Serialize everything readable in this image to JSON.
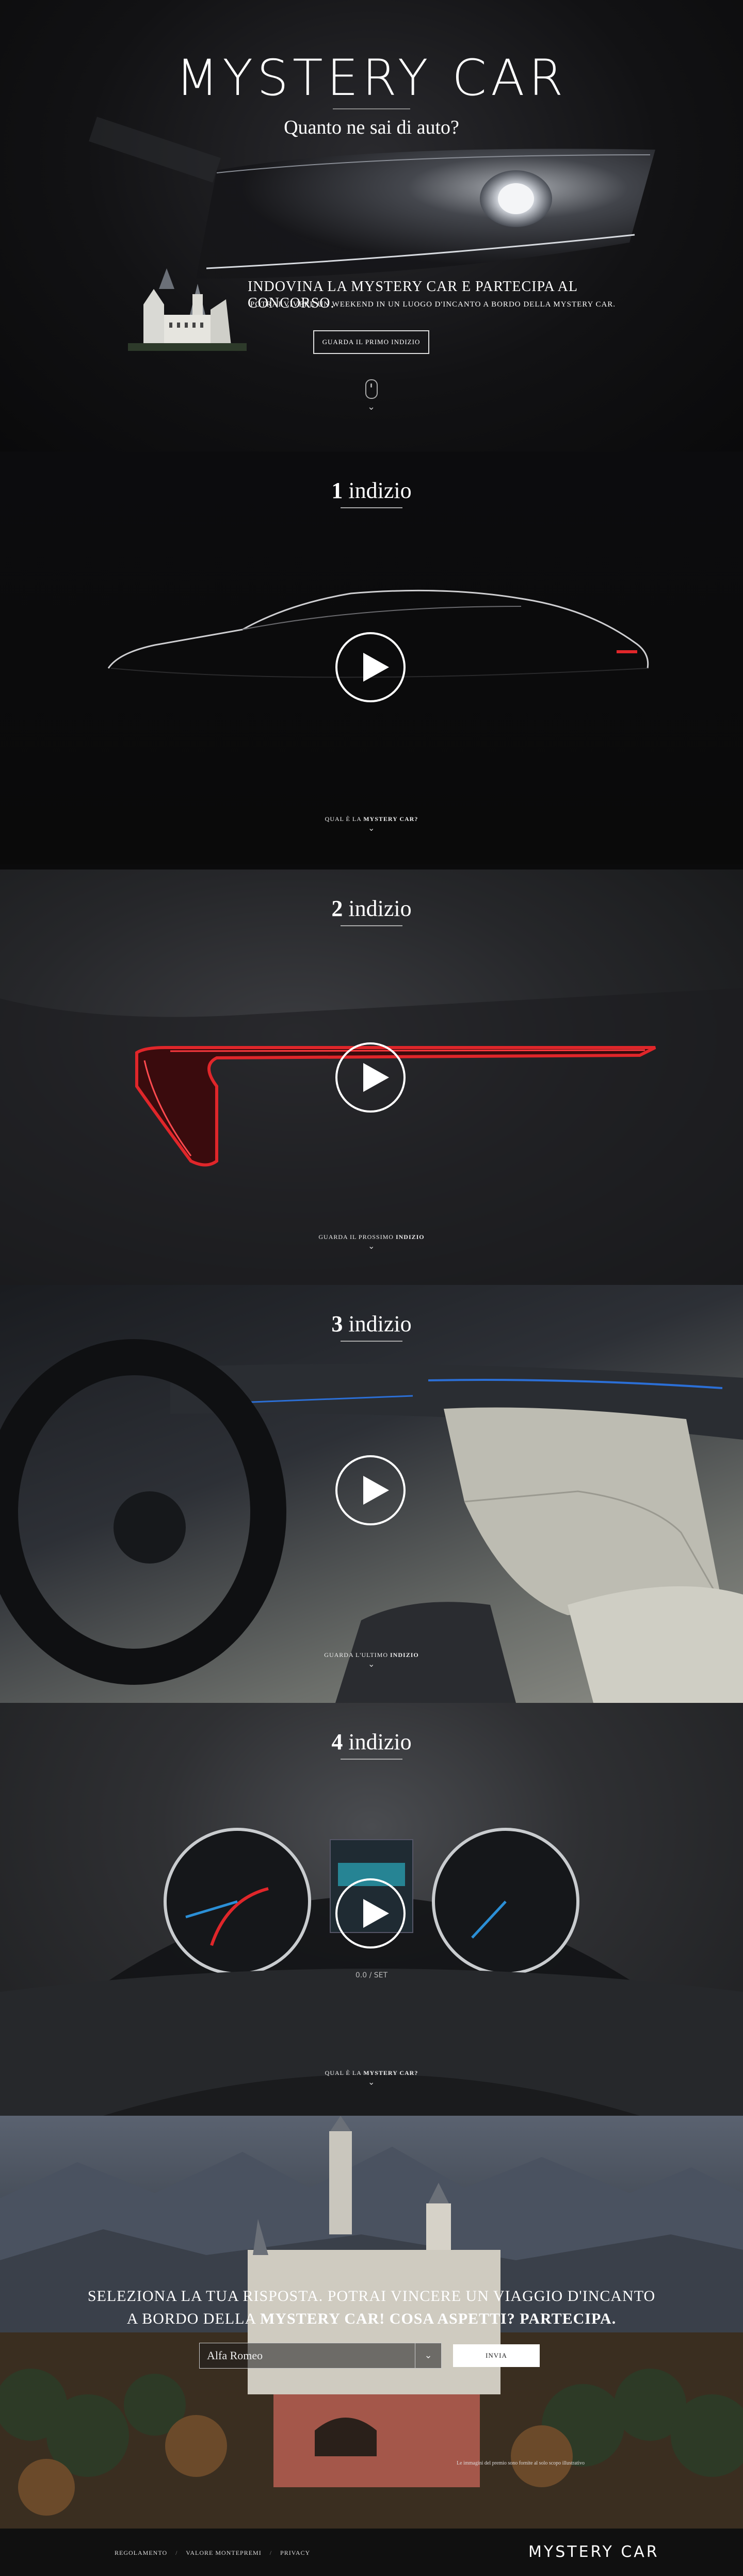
{
  "hero": {
    "title": "MYSTERY CAR",
    "subtitle": "Quanto ne sai di auto?",
    "headline": "INDOVINA LA MYSTERY CAR E PARTECIPA AL CONCORSO.",
    "small_text": "POTRAI VIVERE UN WEEKEND IN UN LUOGO D'INCANTO A BORDO DELLA MYSTERY CAR.",
    "button_label": "GUARDA IL PRIMO INDIZIO"
  },
  "clues": [
    {
      "number": "1",
      "word": "indizio",
      "next_prefix": "QUAL È LA",
      "next_bold": "MYSTERY CAR?"
    },
    {
      "number": "2",
      "word": "indizio",
      "next_prefix": "GUARDA IL PROSSIMO",
      "next_bold": "INDIZIO"
    },
    {
      "number": "3",
      "word": "indizio",
      "next_prefix": "GUARDA L'ULTIMO",
      "next_bold": "INDIZIO"
    },
    {
      "number": "4",
      "word": "indizio",
      "next_prefix": "QUAL È LA",
      "next_bold": "MYSTERY CAR?"
    }
  ],
  "contest": {
    "line1": "SELEZIONA LA TUA RISPOSTA. POTRAI VINCERE UN VIAGGIO D'INCANTO",
    "line2_prefix": "A BORDO DELLA",
    "line2_bold": "MYSTERY CAR! COSA ASPETTI? PARTECIPA.",
    "select_value": "Alfa Romeo",
    "send_label": "INVIA",
    "disclaimer": "Le immagini del premio sono fornite al solo scopo illustrativo"
  },
  "dashboard": {
    "odometer": "0.0 / SET"
  },
  "footer": {
    "links": [
      "REGOLAMENTO",
      "VALORE MONTEPREMI",
      "PRIVACY"
    ],
    "logo": "MYSTERY CAR"
  },
  "colors": {
    "accent_red": "#e0262a",
    "ambient_blue": "#2b6fd6"
  }
}
